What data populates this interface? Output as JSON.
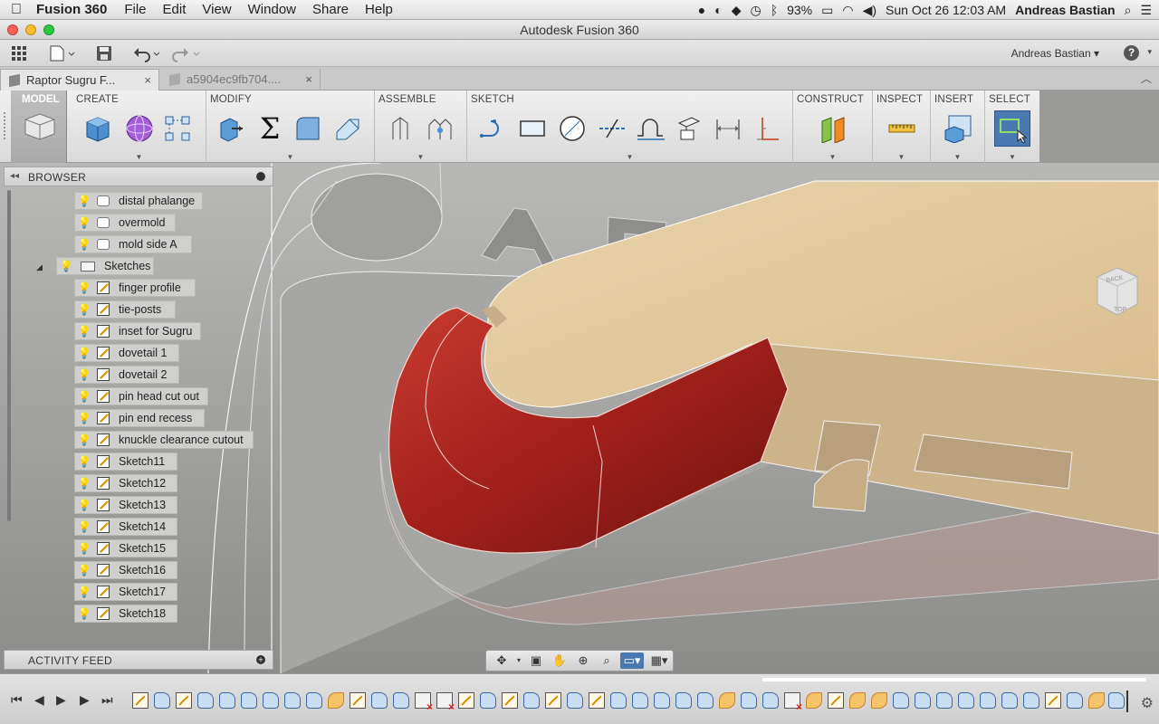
{
  "menubar": {
    "app_name": "Fusion 360",
    "items": [
      "File",
      "Edit",
      "View",
      "Window",
      "Share",
      "Help"
    ],
    "battery": "93%",
    "clock": "Sun Oct 26  12:03 AM",
    "user": "Andreas Bastian"
  },
  "window": {
    "title": "Autodesk Fusion 360"
  },
  "quick_access": {
    "user": "Andreas Bastian ▾",
    "help": "?"
  },
  "tabs": [
    {
      "label": "Raptor Sugru F...",
      "close": "×"
    },
    {
      "label": "a5904ec9fb704....",
      "close": "×"
    }
  ],
  "ribbon": {
    "workspace": "MODEL",
    "panels": [
      "CREATE",
      "MODIFY",
      "ASSEMBLE",
      "SKETCH",
      "CONSTRUCT",
      "INSPECT",
      "INSERT",
      "SELECT"
    ]
  },
  "viewcube": {
    "back": "BACK",
    "top": "TOP"
  },
  "browser": {
    "title": "BROWSER",
    "bodies": [
      {
        "label": "distal phalange"
      },
      {
        "label": "overmold"
      },
      {
        "label": "mold side A"
      }
    ],
    "sketches_folder": "Sketches",
    "sketches": [
      "finger profile",
      "tie-posts",
      "inset for Sugru",
      "dovetail 1",
      "dovetail 2",
      "pin head cut out",
      "pin end recess",
      "knuckle clearance cutout",
      "Sketch11",
      "Sketch12",
      "Sketch13",
      "Sketch14",
      "Sketch15",
      "Sketch16",
      "Sketch17",
      "Sketch18"
    ]
  },
  "activity_feed": {
    "title": "ACTIVITY FEED"
  },
  "colors": {
    "accent": "#4a78b0",
    "model_tan": "#dcc49a",
    "overmold_red": "#a8211d",
    "mold_grey": "#a4a4a2"
  }
}
